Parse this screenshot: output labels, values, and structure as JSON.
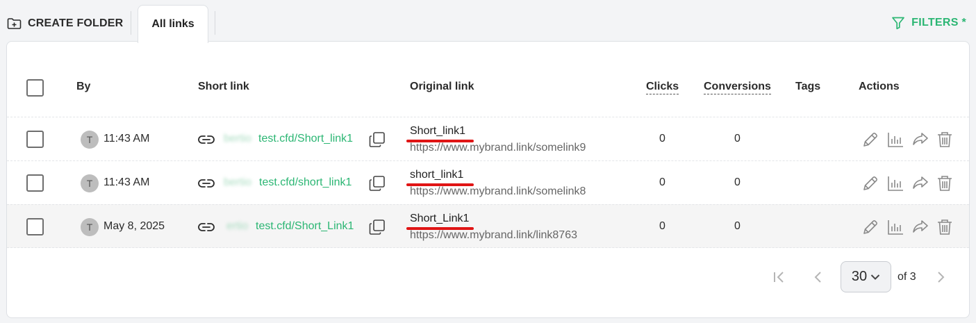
{
  "toolbar": {
    "create_folder_label": "CREATE FOLDER",
    "tab_label": "All links",
    "filters_label": "FILTERS *",
    "accent_color": "#2bb673"
  },
  "table": {
    "headers": {
      "by": "By",
      "short_link": "Short link",
      "original_link": "Original link",
      "clicks": "Clicks",
      "conversions": "Conversions",
      "tags": "Tags",
      "actions": "Actions"
    },
    "rows": [
      {
        "avatar": "T",
        "date": "11:43 AM",
        "domain_blurred": "bertio",
        "short_url": "test.cfd/Short_link1",
        "original_title": "Short_link1",
        "original_url": "https://www.mybrand.link/somelink9",
        "clicks": "0",
        "conversions": "0",
        "tags": ""
      },
      {
        "avatar": "T",
        "date": "11:43 AM",
        "domain_blurred": "bertio",
        "short_url": "test.cfd/short_link1",
        "original_title": "short_link1",
        "original_url": "https://www.mybrand.link/somelink8",
        "clicks": "0",
        "conversions": "0",
        "tags": ""
      },
      {
        "avatar": "T",
        "date": "May 8, 2025",
        "domain_blurred": "ertio",
        "short_url": "test.cfd/Short_Link1",
        "original_title": "Short_Link1",
        "original_url": "https://www.mybrand.link/link8763",
        "clicks": "0",
        "conversions": "0",
        "tags": ""
      }
    ],
    "action_icons": [
      "edit-icon",
      "stats-icon",
      "share-icon",
      "delete-icon"
    ]
  },
  "pagination": {
    "per_page": "30",
    "of_pages": "of 3"
  }
}
